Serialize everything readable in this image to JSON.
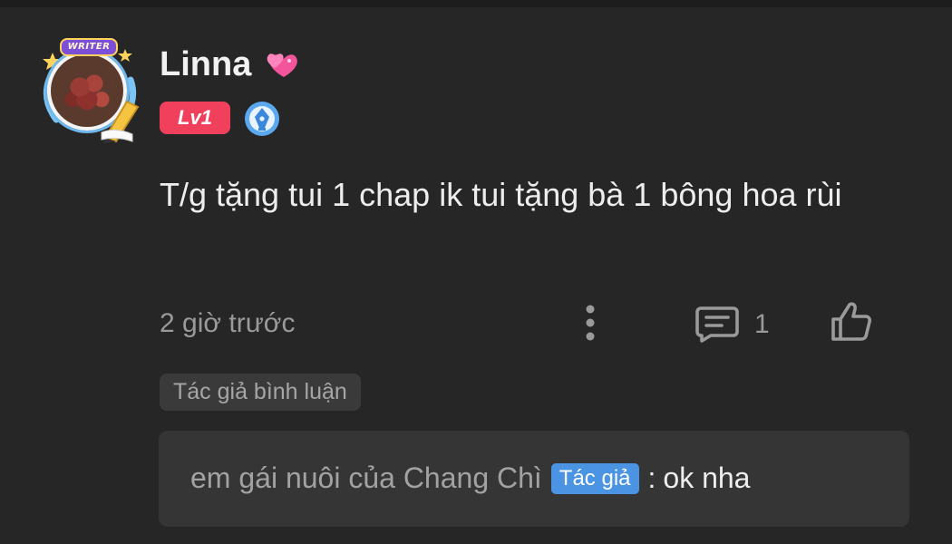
{
  "user": {
    "name": "Linna",
    "avatar_badge": "WRITER",
    "level": "Lv1"
  },
  "comment": {
    "text": "T/g tặng tui 1 chap ik tui tặng bà 1 bông hoa rùi",
    "time": "2 giờ trước",
    "reply_count": "1",
    "author_tag": "Tác giả bình luận"
  },
  "reply": {
    "author": "em gái nuôi của Chang Chì",
    "badge": "Tác giả",
    "separator": ":",
    "message": "ok nha"
  },
  "icons": {
    "heart": "two-hearts-icon",
    "verified": "pen-nib-verified-icon",
    "more": "vertical-dots-icon",
    "reply": "comment-icon",
    "like": "thumbs-up-icon"
  },
  "colors": {
    "background": "#262626",
    "level_badge": "#f0405c",
    "author_badge": "#4a94e3",
    "muted_text": "#9a9a9a"
  }
}
